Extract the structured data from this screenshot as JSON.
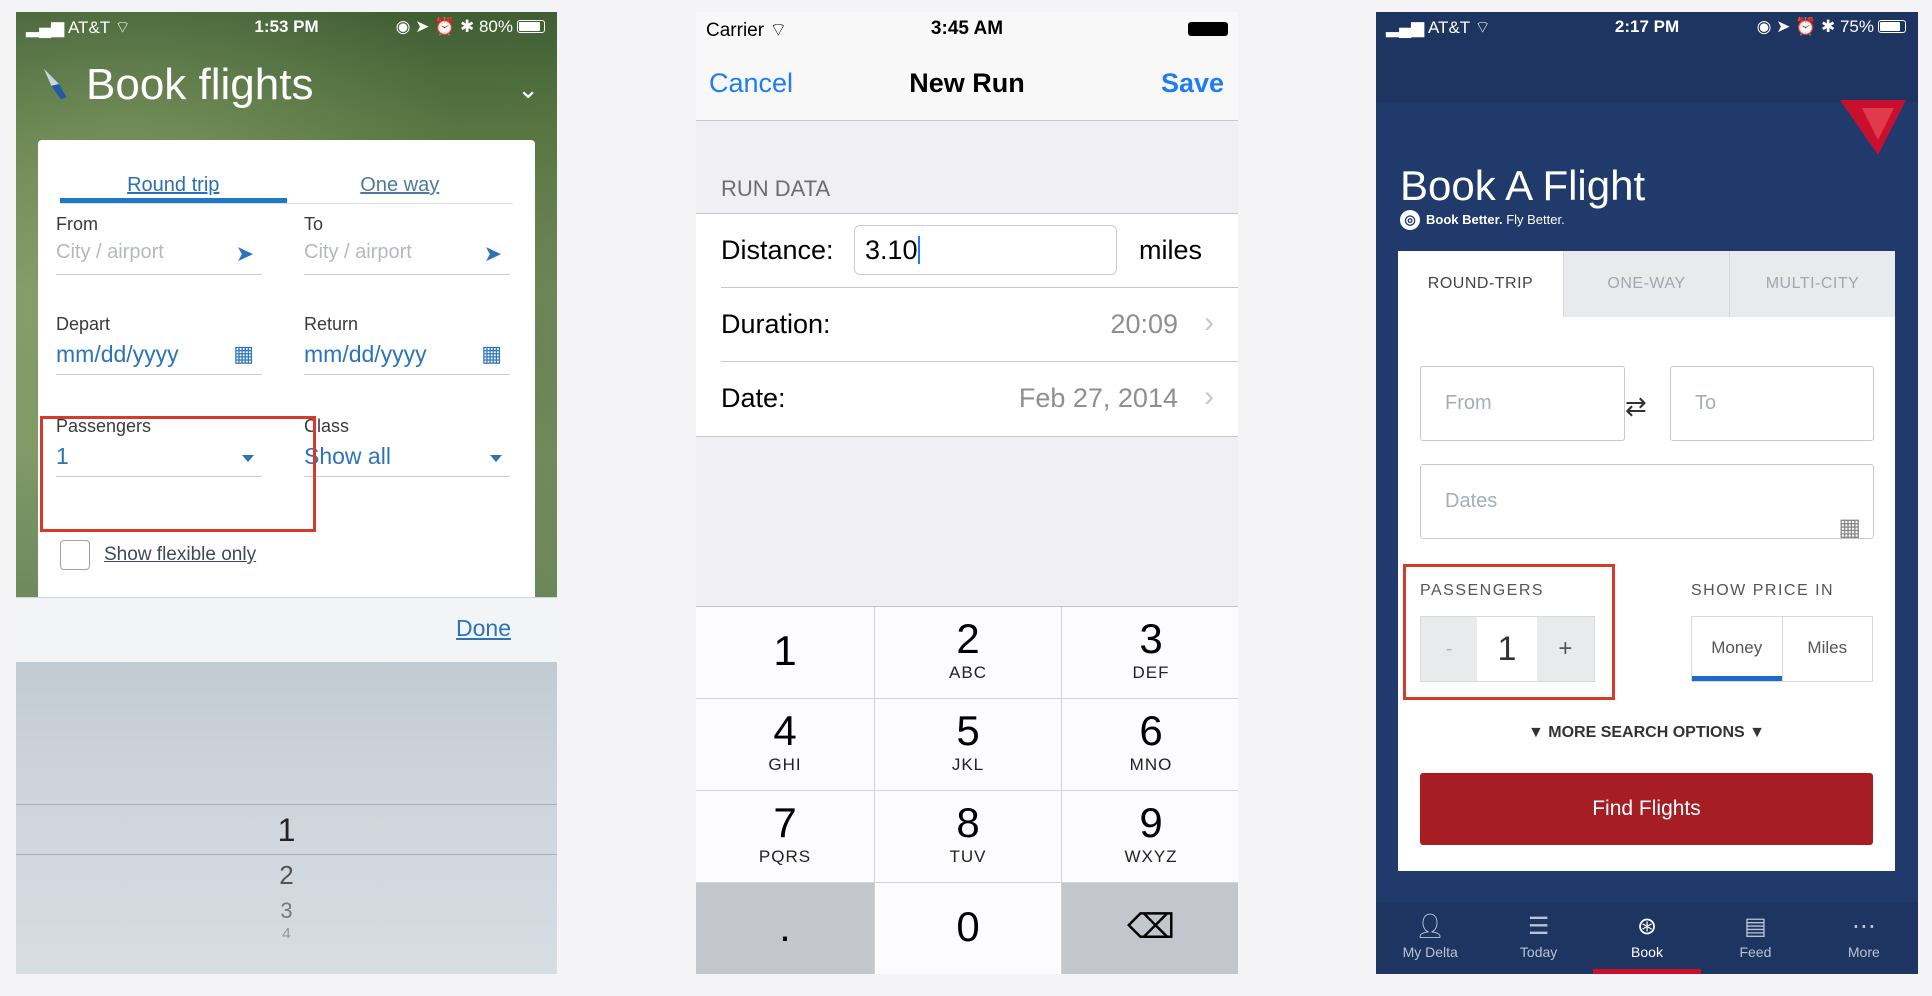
{
  "aa": {
    "status": {
      "carrier": "AT&T",
      "time": "1:53 PM",
      "battery": "80%"
    },
    "title": "Book flights",
    "tabs": {
      "round_trip": "Round trip",
      "one_way": "One way"
    },
    "from": {
      "label": "From",
      "placeholder": "City / airport"
    },
    "to": {
      "label": "To",
      "placeholder": "City / airport"
    },
    "depart": {
      "label": "Depart",
      "value": "mm/dd/yyyy"
    },
    "return": {
      "label": "Return",
      "value": "mm/dd/yyyy"
    },
    "passengers": {
      "label": "Passengers",
      "value": "1"
    },
    "class": {
      "label": "Class",
      "value": "Show all"
    },
    "flexible": "Show flexible only",
    "done": "Done",
    "picker": [
      "1",
      "2",
      "3",
      "4"
    ]
  },
  "run": {
    "status": {
      "carrier": "Carrier",
      "time": "3:45 AM"
    },
    "cancel": "Cancel",
    "title": "New Run",
    "save": "Save",
    "section": "RUN DATA",
    "distance": {
      "label": "Distance:",
      "value": "3.10",
      "unit": "miles"
    },
    "duration": {
      "label": "Duration:",
      "value": "20:09"
    },
    "date": {
      "label": "Date:",
      "value": "Feb 27, 2014"
    },
    "keys": [
      {
        "d": "1",
        "l": ""
      },
      {
        "d": "2",
        "l": "ABC"
      },
      {
        "d": "3",
        "l": "DEF"
      },
      {
        "d": "4",
        "l": "GHI"
      },
      {
        "d": "5",
        "l": "JKL"
      },
      {
        "d": "6",
        "l": "MNO"
      },
      {
        "d": "7",
        "l": "PQRS"
      },
      {
        "d": "8",
        "l": "TUV"
      },
      {
        "d": "9",
        "l": "WXYZ"
      },
      {
        "d": ".",
        "l": ""
      },
      {
        "d": "0",
        "l": ""
      },
      {
        "d": "⌫",
        "l": ""
      }
    ]
  },
  "delta": {
    "status": {
      "carrier": "AT&T",
      "time": "2:17 PM",
      "battery": "75%"
    },
    "title": "Book A Flight",
    "tagline_bold": "Book Better.",
    "tagline_rest": " Fly Better.",
    "tabs": {
      "round_trip": "ROUND-TRIP",
      "one_way": "ONE-WAY",
      "multi_city": "MULTI-CITY"
    },
    "from": "From",
    "to": "To",
    "dates": "Dates",
    "passengers_label": "PASSENGERS",
    "passengers": {
      "minus": "-",
      "value": "1",
      "plus": "+"
    },
    "show_price_label": "SHOW PRICE IN",
    "price": {
      "money": "Money",
      "miles": "Miles"
    },
    "more_options": "▼ MORE SEARCH OPTIONS ▼",
    "find": "Find Flights",
    "tabbar": {
      "my_delta": "My Delta",
      "today": "Today",
      "book": "Book",
      "feed": "Feed",
      "more": "More"
    }
  },
  "colors": {
    "aa_blue": "#2c74b8",
    "ios_blue": "#1f7cf3",
    "delta_navy": "#203a6b",
    "delta_red": "#a61d24",
    "highlight_red": "#d63a2b"
  }
}
